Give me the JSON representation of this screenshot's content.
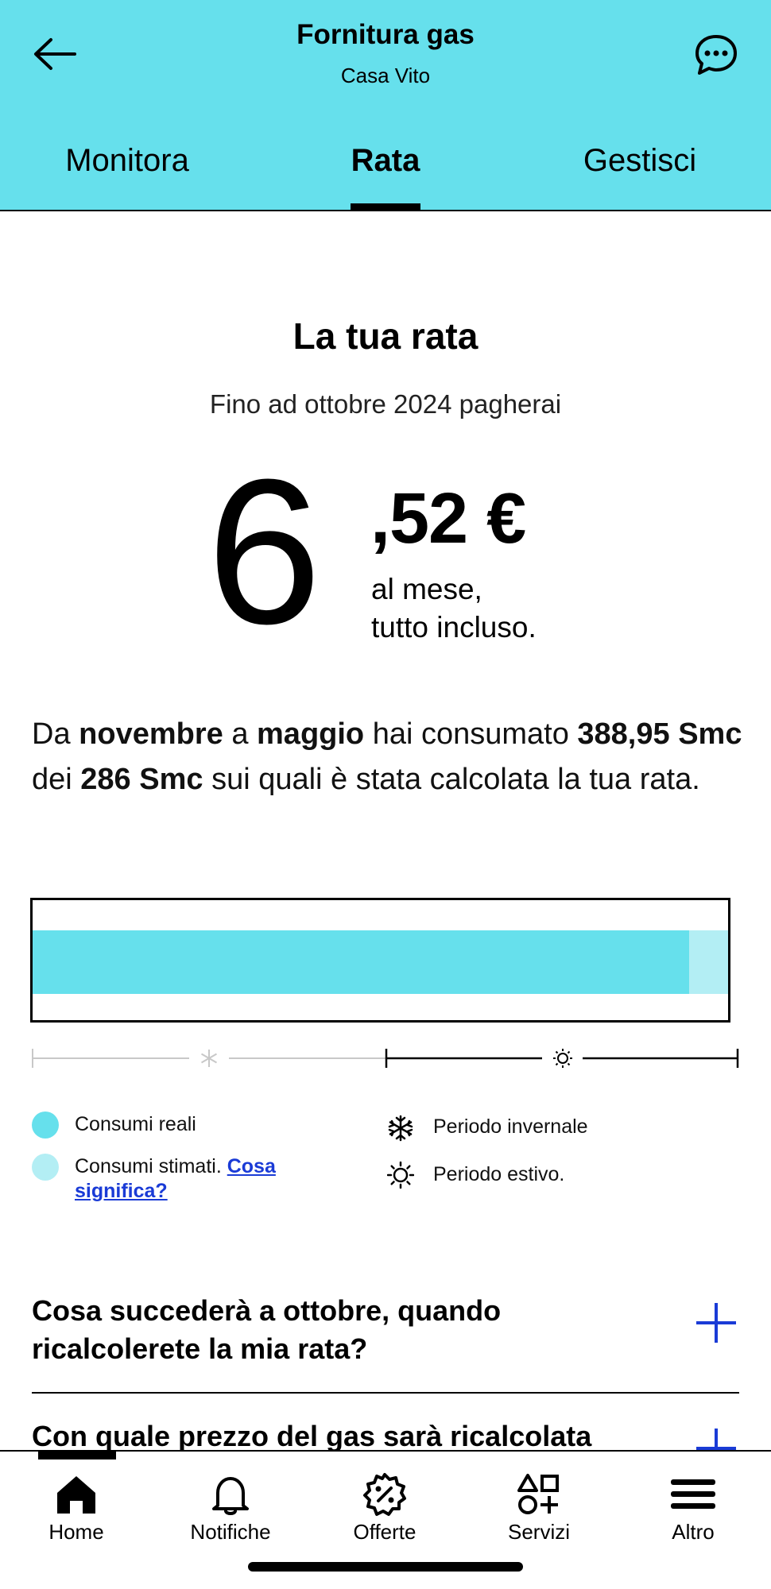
{
  "header": {
    "title": "Fornitura gas",
    "subtitle": "Casa Vito",
    "back_icon": "arrow-left-icon",
    "chat_icon": "chat-bubble-icon",
    "background": "#66e0ec"
  },
  "tabs": [
    {
      "label": "Monitora"
    },
    {
      "label": "Rata",
      "active": true
    },
    {
      "label": "Gestisci"
    }
  ],
  "rate": {
    "title": "La tua rata",
    "subtitle": "Fino ad ottobre 2024 pagherai",
    "amount_integer": "6",
    "amount_decimal": ",52 €",
    "per_month_line1": "al mese,",
    "per_month_line2": "tutto incluso."
  },
  "consumption": {
    "p1": "Da ",
    "month_from": "novembre",
    "p2": " a ",
    "month_to": "maggio",
    "p3": " hai consumato ",
    "consumed": "388,95 Smc",
    "p4": " dei ",
    "baseline": "286 Smc",
    "p5": " sui quali è stata calcolata la tua rata.",
    "real_fraction": 0.944,
    "estimated_fraction": 0.056
  },
  "legend": {
    "real": "Consumi reali",
    "estimated": "Consumi stimati.",
    "estimated_link": "Cosa significa?",
    "winter": "Periodo invernale",
    "summer": "Periodo estivo.",
    "winter_icon": "snowflake-icon",
    "summer_icon": "sun-icon",
    "real_color": "#66e0ec",
    "estimated_color": "#b3eef4"
  },
  "faq": [
    {
      "question": "Cosa succederà a ottobre, quando ricalcolerete la mia rata?"
    },
    {
      "question": "Con quale prezzo del gas sarà ricalcolata"
    }
  ],
  "bottom_nav": [
    {
      "label": "Home",
      "icon": "home-icon",
      "active": true
    },
    {
      "label": "Notifiche",
      "icon": "bell-icon"
    },
    {
      "label": "Offerte",
      "icon": "discount-badge-icon"
    },
    {
      "label": "Servizi",
      "icon": "services-grid-icon"
    },
    {
      "label": "Altro",
      "icon": "menu-icon"
    }
  ],
  "accent_link_color": "#1a3bd6"
}
